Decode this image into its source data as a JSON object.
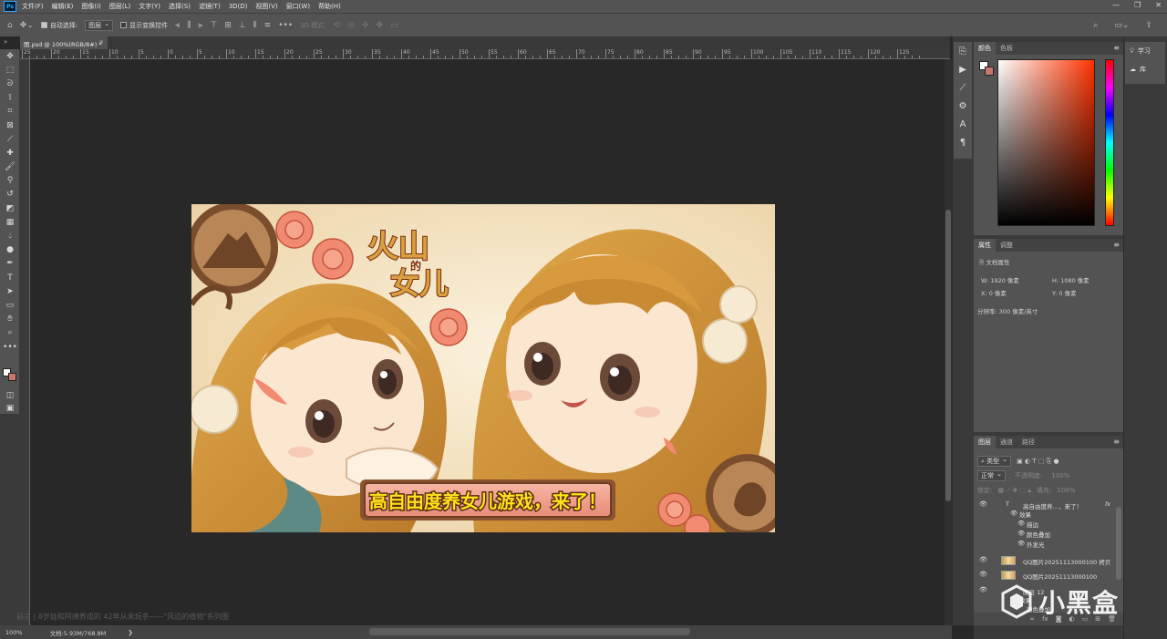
{
  "menubar": {
    "app_logo": "Ps",
    "items": [
      "文件(F)",
      "编辑(E)",
      "图像(I)",
      "图层(L)",
      "文字(Y)",
      "选择(S)",
      "滤镜(T)",
      "3D(D)",
      "视图(V)",
      "窗口(W)",
      "帮助(H)"
    ],
    "window_controls": [
      "—",
      "❐",
      "✕"
    ]
  },
  "options_bar": {
    "auto_select_label": "自动选择:",
    "auto_select_checked": true,
    "auto_select_target": "图层",
    "show_transform_label": "显示变换控件",
    "show_transform_checked": false,
    "more": "•••",
    "mode_3d_label": "3D 模式:"
  },
  "document": {
    "tab_title": "图.psd @ 100%(RGB/8#) *",
    "zoom": "100%",
    "doc_size": "文档:5.93M/768.8M"
  },
  "ruler_labels": [
    "25",
    "20",
    "15",
    "10",
    "5",
    "0",
    "5",
    "10",
    "15",
    "20",
    "25",
    "30",
    "35",
    "40",
    "45",
    "50",
    "55",
    "60",
    "65",
    "70",
    "75",
    "80",
    "85",
    "90",
    "95",
    "100",
    "105",
    "110",
    "115",
    "120",
    "125"
  ],
  "artwork": {
    "logo_line1": "火山",
    "logo_small": "的",
    "logo_line2": "女儿",
    "banner_text": "高自由度养女儿游戏，来了！"
  },
  "caption": "前言 | 8岁娃和阿姨养成的 42年从未玩手——\"风边的植物\"系列图",
  "color_panel": {
    "tabs": [
      "颜色",
      "色板"
    ],
    "fg_color": "#ffffff",
    "bg_color": "#c9766a",
    "picker_hue": "#ff3300"
  },
  "properties_panel": {
    "tabs": [
      "属性",
      "调整"
    ],
    "section": "文档属性",
    "w_label": "W:",
    "w_value": "1920 像素",
    "h_label": "H:",
    "h_value": "1080 像素",
    "x_label": "X:",
    "x_value": "0 像素",
    "y_label": "Y:",
    "y_value": "0 像素",
    "resolution": "分辨率: 300 像素/英寸"
  },
  "learn_panel": {
    "learn": "学习",
    "library": "库"
  },
  "layers_panel": {
    "tabs": [
      "图层",
      "通道",
      "路径"
    ],
    "filter": "类型",
    "blend_mode": "正常",
    "opacity_label": "不透明度:",
    "opacity_value": "100%",
    "lock_label": "锁定:",
    "fill_label": "填充:",
    "fill_value": "100%",
    "layers": [
      {
        "type": "text",
        "name": "高自由度养…，来了！",
        "fx": "fx"
      },
      {
        "type": "effect-header",
        "name": "效果"
      },
      {
        "type": "effect",
        "name": "描边"
      },
      {
        "type": "effect",
        "name": "颜色叠加"
      },
      {
        "type": "effect",
        "name": "外发光"
      },
      {
        "type": "image",
        "name": "QQ图片20251113000100 拷贝"
      },
      {
        "type": "image",
        "name": "QQ图片20251113000100"
      },
      {
        "type": "image",
        "name": "图层 12"
      },
      {
        "type": "effect-header",
        "name": "效果"
      },
      {
        "type": "effect",
        "name": "颜色叠加"
      }
    ]
  },
  "watermark": {
    "name": "小黑盒"
  }
}
